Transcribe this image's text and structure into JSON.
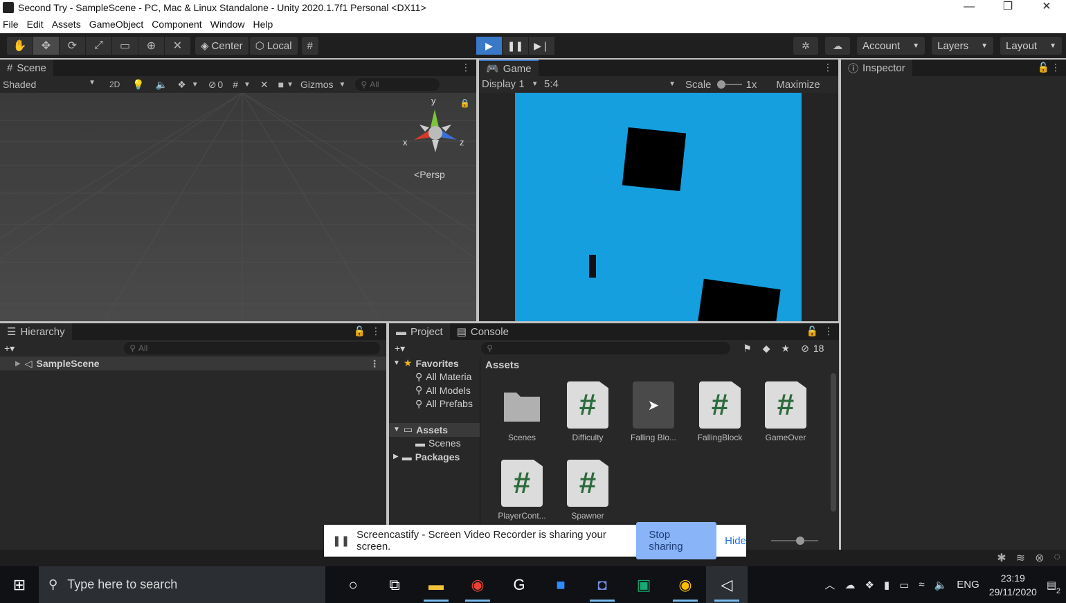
{
  "window": {
    "title": "Second Try - SampleScene - PC, Mac & Linux Standalone - Unity 2020.1.7f1 Personal <DX11>",
    "controls": [
      "—",
      "❐",
      "✕"
    ]
  },
  "menu": [
    "File",
    "Edit",
    "Assets",
    "GameObject",
    "Component",
    "Window",
    "Help"
  ],
  "toolbar": {
    "pivot": "Center",
    "space": "Local",
    "account": "Account",
    "layers": "Layers",
    "layout": "Layout"
  },
  "scene": {
    "tab": "Scene",
    "shading": "Shaded",
    "mode2d": "2D",
    "hidden_count": "0",
    "gizmos": "Gizmos",
    "search_placeholder": "All",
    "persp": "Persp",
    "axis_x": "x",
    "axis_y": "y",
    "axis_z": "z"
  },
  "game": {
    "tab": "Game",
    "display": "Display 1",
    "aspect": "5:4",
    "scale_label": "Scale",
    "scale_value": "1x",
    "maximize": "Maximize"
  },
  "inspector": {
    "tab": "Inspector"
  },
  "hierarchy": {
    "tab": "Hierarchy",
    "search_placeholder": "All",
    "scene_name": "SampleScene"
  },
  "project": {
    "tab_project": "Project",
    "tab_console": "Console",
    "hidden_count": "18",
    "favorites": "Favorites",
    "fav_items": [
      "All Materia",
      "All Models",
      "All Prefabs"
    ],
    "assets_root": "Assets",
    "scenes_folder": "Scenes",
    "packages": "Packages",
    "breadcrumb": "Assets",
    "assets": [
      {
        "name": "Scenes",
        "kind": "folder"
      },
      {
        "name": "Difficulty",
        "kind": "script"
      },
      {
        "name": "Falling Blo...",
        "kind": "selected"
      },
      {
        "name": "FallingBlock",
        "kind": "script"
      },
      {
        "name": "GameOver",
        "kind": "script"
      },
      {
        "name": "PlayerCont...",
        "kind": "script"
      },
      {
        "name": "Spawner",
        "kind": "script"
      }
    ]
  },
  "sharebar": {
    "message": "Screencastify - Screen Video Recorder is sharing your screen.",
    "stop": "Stop sharing",
    "hide": "Hide"
  },
  "taskbar": {
    "search_placeholder": "Type here to search",
    "lang": "ENG",
    "time": "23:19",
    "date": "29/11/2020",
    "notifications": "2"
  },
  "colors": {
    "game_background": "#159fdf",
    "play_active": "#3a78c8",
    "stop_button": "#8ab4f8"
  }
}
